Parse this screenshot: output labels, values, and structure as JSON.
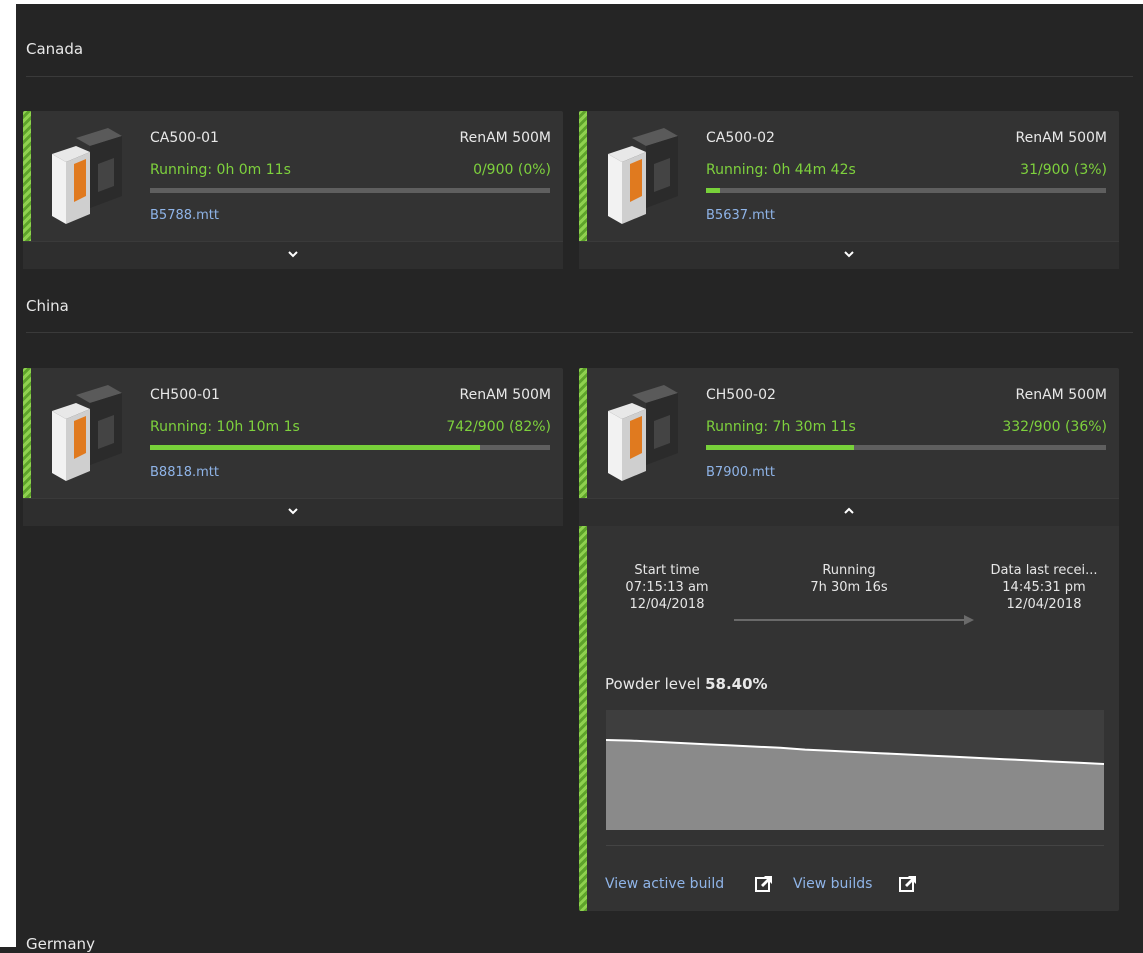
{
  "sections": [
    {
      "title": "Canada"
    },
    {
      "title": "China"
    },
    {
      "title": "Germany"
    }
  ],
  "cards": [
    {
      "name": "CA500-01",
      "model": "RenAM 500M",
      "status": "Running: 0h 0m 11s",
      "progress_text": "0/900 (0%)",
      "progress": 0.0,
      "file": "B5788.mtt",
      "expanded": false
    },
    {
      "name": "CA500-02",
      "model": "RenAM 500M",
      "status": "Running: 0h 44m 42s",
      "progress_text": "31/900 (3%)",
      "progress": 0.034,
      "file": "B5637.mtt",
      "expanded": false
    },
    {
      "name": "CH500-01",
      "model": "RenAM 500M",
      "status": "Running: 10h 10m 1s",
      "progress_text": "742/900 (82%)",
      "progress": 0.824,
      "file": "B8818.mtt",
      "expanded": false
    },
    {
      "name": "CH500-02",
      "model": "RenAM 500M",
      "status": "Running: 7h 30m 11s",
      "progress_text": "332/900 (36%)",
      "progress": 0.369,
      "file": "B7900.mtt",
      "expanded": true
    }
  ],
  "detail": {
    "start": {
      "label": "Start time",
      "time": "07:15:13 am",
      "date": "12/04/2018"
    },
    "running": {
      "label": "Running",
      "value": "7h 30m 16s"
    },
    "last": {
      "label": "Data last recei...",
      "time": "14:45:31 pm",
      "date": "12/04/2018"
    },
    "powder_label": "Powder level",
    "powder_value": "58.40%",
    "view_active_build": "View active build",
    "view_builds": "View builds"
  },
  "chart_data": {
    "type": "area",
    "title": "Powder level",
    "series": [
      {
        "values": [
          0.75,
          0.745,
          0.735,
          0.725,
          0.715,
          0.705,
          0.695,
          0.685,
          0.67,
          0.66,
          0.65,
          0.64,
          0.63,
          0.62,
          0.61,
          0.6,
          0.59,
          0.58,
          0.57,
          0.56,
          0.55
        ]
      }
    ],
    "ylim": [
      0,
      1
    ],
    "grid": false
  },
  "colors": {
    "accent_green": "#7ed13d",
    "link_blue": "#8fb4e8",
    "background": "#252525",
    "card": "#333333"
  }
}
